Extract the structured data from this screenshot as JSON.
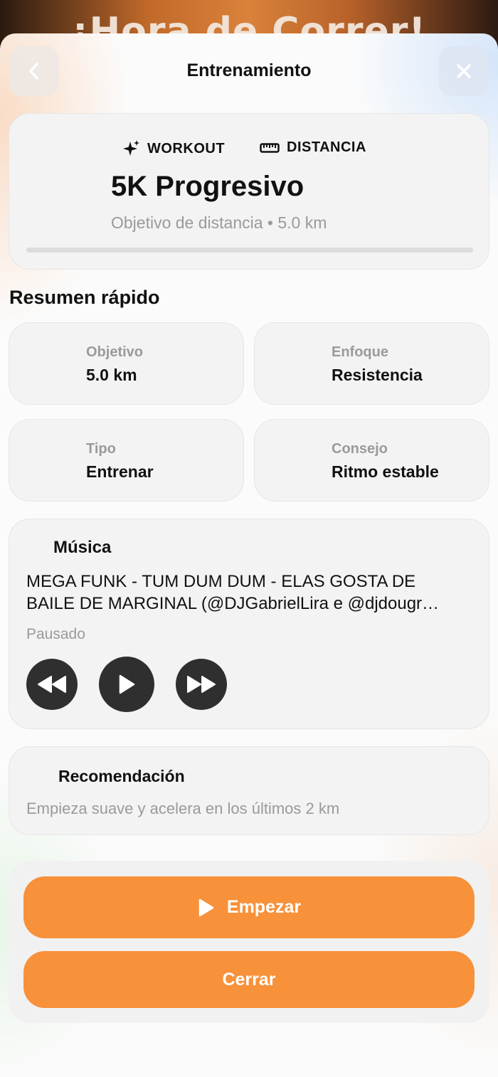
{
  "background": {
    "title": "¡Hora de Correr!"
  },
  "nav": {
    "title": "Entrenamiento",
    "back_icon": "chevron-left-icon",
    "close_icon": "close-icon"
  },
  "header": {
    "tag_workout": "WORKOUT",
    "tag_distance": "DISTANCIA",
    "workout_name": "5K Progresivo",
    "subtitle": "Objetivo de distancia • 5.0 km",
    "progress": 0
  },
  "summary": {
    "title": "Resumen rápido",
    "items": [
      {
        "label": "Objetivo",
        "value": "5.0 km"
      },
      {
        "label": "Enfoque",
        "value": "Resistencia"
      },
      {
        "label": "Tipo",
        "value": "Entrenar"
      },
      {
        "label": "Consejo",
        "value": "Ritmo estable"
      }
    ]
  },
  "music": {
    "title": "Música",
    "track_line1": "MEGA FUNK - TUM DUM DUM - ELAS GOSTA DE",
    "track_line2": "BAILE DE MARGINAL (@DJGabrielLira e @djdougr…",
    "status": "Pausado"
  },
  "recommendation": {
    "title": "Recomendación",
    "text": "Empieza suave y acelera en los últimos 2 km"
  },
  "actions": {
    "start_label": "Empezar",
    "close_label": "Cerrar"
  },
  "colors": {
    "accent": "#f7913a",
    "card": "#f3f3f3",
    "control": "#2f2f2f"
  }
}
